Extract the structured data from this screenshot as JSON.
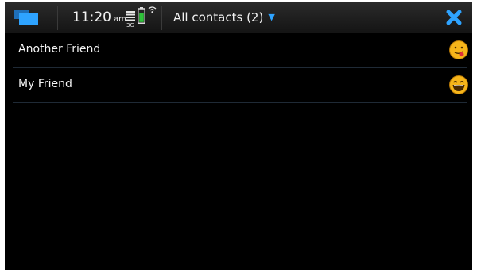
{
  "statusbar": {
    "time": "11:20",
    "ampm": "am",
    "network": "3G",
    "view_menu_label": "All contacts (2)",
    "task_switcher_icon": "task-switcher-icon",
    "close_icon": "close-icon",
    "accent_color": "#2ea3ff"
  },
  "contacts": [
    {
      "name": "Another Friend",
      "status_icon": "tongue-smiley-icon"
    },
    {
      "name": "My Friend",
      "status_icon": "laughing-smiley-icon"
    }
  ]
}
